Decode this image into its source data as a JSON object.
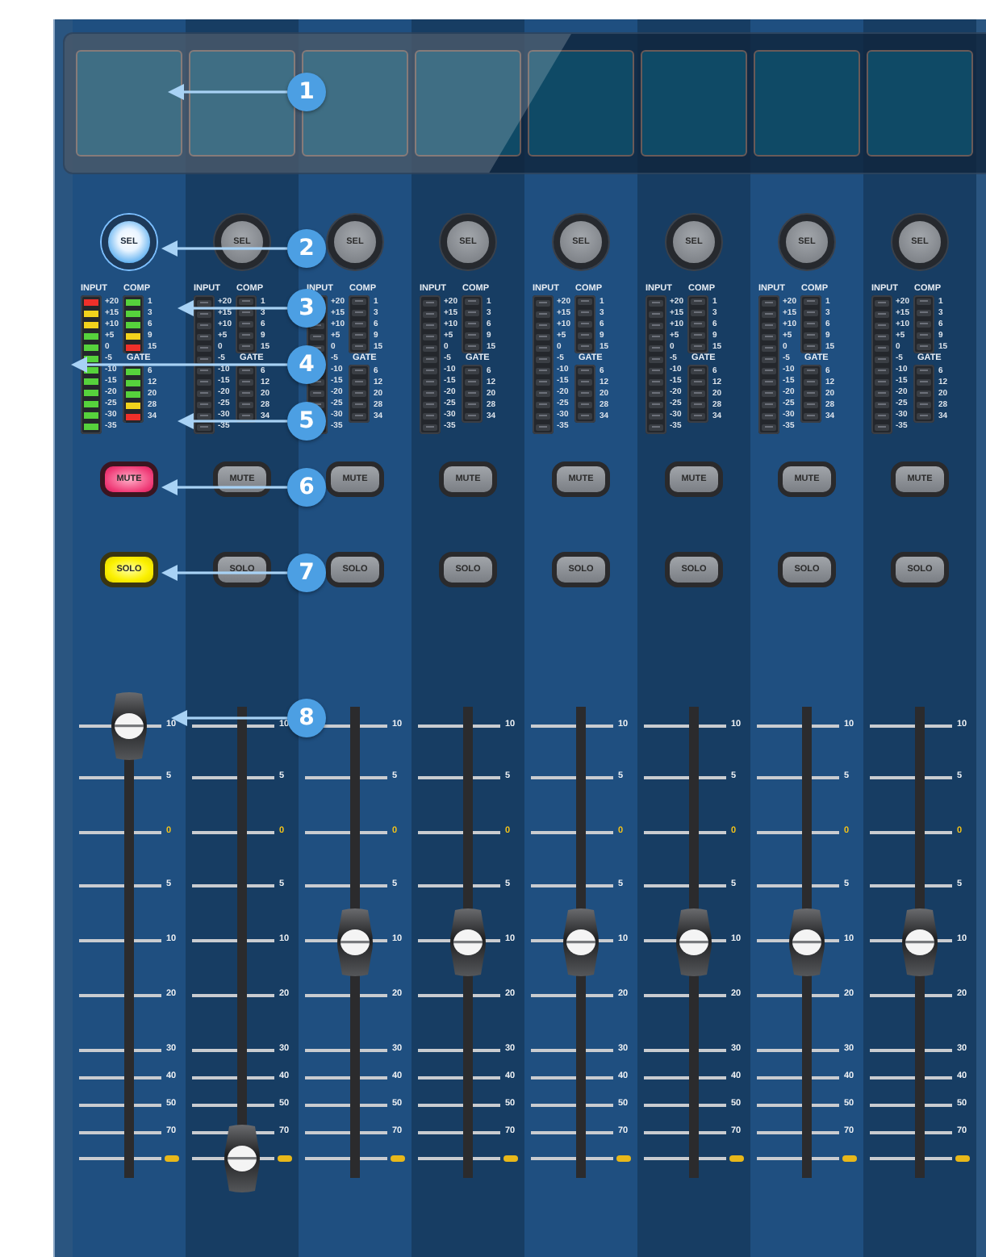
{
  "scribble_strips": [
    {
      "kind": "screen"
    },
    {
      "kind": "screen"
    },
    {
      "kind": "screen"
    },
    {
      "kind": "screen"
    },
    {
      "kind": "screen"
    },
    {
      "kind": "screen"
    },
    {
      "kind": "screen"
    },
    {
      "kind": "screen"
    }
  ],
  "channels": [
    {
      "select": {
        "label": "SEL",
        "selected": true
      },
      "meters": [
        {
          "kind": "input",
          "title": "INPUT",
          "scale": [
            "+20",
            "+15",
            "+10",
            "+5",
            "0",
            "-5",
            "-10",
            "-15",
            "-20",
            "-25",
            "-30",
            "-35"
          ],
          "level": 1
        },
        {
          "kind": "comp",
          "title": "COMP",
          "scale": [
            "1",
            "3",
            "6",
            "9",
            "15"
          ],
          "level": 1
        },
        {
          "kind": "gate",
          "title": "GATE",
          "scale": [
            "6",
            "12",
            "20",
            "28",
            "34"
          ],
          "level": 1
        }
      ],
      "mute": {
        "label": "MUTE",
        "on": true
      },
      "solo": {
        "label": "SOLO",
        "on": true
      },
      "fader": {
        "scale": [
          "10",
          "5",
          "0",
          "5",
          "10",
          "20",
          "30",
          "40",
          "50",
          "70"
        ],
        "level": 1
      }
    },
    {
      "select": {
        "label": "SEL",
        "selected": false
      },
      "meters": [
        {
          "kind": "input",
          "title": "INPUT",
          "scale": [
            "+20",
            "+15",
            "+10",
            "+5",
            "0",
            "-5",
            "-10",
            "-15",
            "-20",
            "-25",
            "-30",
            "-35"
          ],
          "level": 0
        },
        {
          "kind": "comp",
          "title": "COMP",
          "scale": [
            "1",
            "3",
            "6",
            "9",
            "15"
          ],
          "level": 0
        },
        {
          "kind": "gate",
          "title": "GATE",
          "scale": [
            "6",
            "12",
            "20",
            "28",
            "34"
          ],
          "level": 0
        }
      ],
      "mute": {
        "label": "MUTE",
        "on": false
      },
      "solo": {
        "label": "SOLO",
        "on": false
      },
      "fader": {
        "scale": [
          "10",
          "5",
          "0",
          "5",
          "10",
          "20",
          "30",
          "40",
          "50",
          "70"
        ],
        "level": 0
      }
    },
    {
      "select": {
        "label": "SEL",
        "selected": false
      },
      "meters": [
        {
          "kind": "input",
          "title": "INPUT",
          "scale": [
            "+20",
            "+15",
            "+10",
            "+5",
            "0",
            "-5",
            "-10",
            "-15",
            "-20",
            "-25",
            "-30",
            "-35"
          ],
          "level": 0
        },
        {
          "kind": "comp",
          "title": "COMP",
          "scale": [
            "1",
            "3",
            "6",
            "9",
            "15"
          ],
          "level": 0
        },
        {
          "kind": "gate",
          "title": "GATE",
          "scale": [
            "6",
            "12",
            "20",
            "28",
            "34"
          ],
          "level": 0
        }
      ],
      "mute": {
        "label": "MUTE",
        "on": false
      },
      "solo": {
        "label": "SOLO",
        "on": false
      },
      "fader": {
        "scale": [
          "10",
          "5",
          "0",
          "5",
          "10",
          "20",
          "30",
          "40",
          "50",
          "70"
        ],
        "level": 0.5
      }
    },
    {
      "select": {
        "label": "SEL",
        "selected": false
      },
      "meters": [
        {
          "kind": "input",
          "title": "INPUT",
          "scale": [
            "+20",
            "+15",
            "+10",
            "+5",
            "0",
            "-5",
            "-10",
            "-15",
            "-20",
            "-25",
            "-30",
            "-35"
          ],
          "level": 0
        },
        {
          "kind": "comp",
          "title": "COMP",
          "scale": [
            "1",
            "3",
            "6",
            "9",
            "15"
          ],
          "level": 0
        },
        {
          "kind": "gate",
          "title": "GATE",
          "scale": [
            "6",
            "12",
            "20",
            "28",
            "34"
          ],
          "level": 0
        }
      ],
      "mute": {
        "label": "MUTE",
        "on": false
      },
      "solo": {
        "label": "SOLO",
        "on": false
      },
      "fader": {
        "scale": [
          "10",
          "5",
          "0",
          "5",
          "10",
          "20",
          "30",
          "40",
          "50",
          "70"
        ],
        "level": 0.5
      }
    },
    {
      "select": {
        "label": "SEL",
        "selected": false
      },
      "meters": [
        {
          "kind": "input",
          "title": "INPUT",
          "scale": [
            "+20",
            "+15",
            "+10",
            "+5",
            "0",
            "-5",
            "-10",
            "-15",
            "-20",
            "-25",
            "-30",
            "-35"
          ],
          "level": 0
        },
        {
          "kind": "comp",
          "title": "COMP",
          "scale": [
            "1",
            "3",
            "6",
            "9",
            "15"
          ],
          "level": 0
        },
        {
          "kind": "gate",
          "title": "GATE",
          "scale": [
            "6",
            "12",
            "20",
            "28",
            "34"
          ],
          "level": 0
        }
      ],
      "mute": {
        "label": "MUTE",
        "on": false
      },
      "solo": {
        "label": "SOLO",
        "on": false
      },
      "fader": {
        "scale": [
          "10",
          "5",
          "0",
          "5",
          "10",
          "20",
          "30",
          "40",
          "50",
          "70"
        ],
        "level": 0.5
      }
    },
    {
      "select": {
        "label": "SEL",
        "selected": false
      },
      "meters": [
        {
          "kind": "input",
          "title": "INPUT",
          "scale": [
            "+20",
            "+15",
            "+10",
            "+5",
            "0",
            "-5",
            "-10",
            "-15",
            "-20",
            "-25",
            "-30",
            "-35"
          ],
          "level": 0
        },
        {
          "kind": "comp",
          "title": "COMP",
          "scale": [
            "1",
            "3",
            "6",
            "9",
            "15"
          ],
          "level": 0
        },
        {
          "kind": "gate",
          "title": "GATE",
          "scale": [
            "6",
            "12",
            "20",
            "28",
            "34"
          ],
          "level": 0
        }
      ],
      "mute": {
        "label": "MUTE",
        "on": false
      },
      "solo": {
        "label": "SOLO",
        "on": false
      },
      "fader": {
        "scale": [
          "10",
          "5",
          "0",
          "5",
          "10",
          "20",
          "30",
          "40",
          "50",
          "70"
        ],
        "level": 0.5
      }
    },
    {
      "select": {
        "label": "SEL",
        "selected": false
      },
      "meters": [
        {
          "kind": "input",
          "title": "INPUT",
          "scale": [
            "+20",
            "+15",
            "+10",
            "+5",
            "0",
            "-5",
            "-10",
            "-15",
            "-20",
            "-25",
            "-30",
            "-35"
          ],
          "level": 0
        },
        {
          "kind": "comp",
          "title": "COMP",
          "scale": [
            "1",
            "3",
            "6",
            "9",
            "15"
          ],
          "level": 0
        },
        {
          "kind": "gate",
          "title": "GATE",
          "scale": [
            "6",
            "12",
            "20",
            "28",
            "34"
          ],
          "level": 0
        }
      ],
      "mute": {
        "label": "MUTE",
        "on": false
      },
      "solo": {
        "label": "SOLO",
        "on": false
      },
      "fader": {
        "scale": [
          "10",
          "5",
          "0",
          "5",
          "10",
          "20",
          "30",
          "40",
          "50",
          "70"
        ],
        "level": 0.5
      }
    },
    {
      "select": {
        "label": "SEL",
        "selected": false
      },
      "meters": [
        {
          "kind": "input",
          "title": "INPUT",
          "scale": [
            "+20",
            "+15",
            "+10",
            "+5",
            "0",
            "-5",
            "-10",
            "-15",
            "-20",
            "-25",
            "-30",
            "-35"
          ],
          "level": 0
        },
        {
          "kind": "comp",
          "title": "COMP",
          "scale": [
            "1",
            "3",
            "6",
            "9",
            "15"
          ],
          "level": 0
        },
        {
          "kind": "gate",
          "title": "GATE",
          "scale": [
            "6",
            "12",
            "20",
            "28",
            "34"
          ],
          "level": 0
        }
      ],
      "mute": {
        "label": "MUTE",
        "on": false
      },
      "solo": {
        "label": "SOLO",
        "on": false
      },
      "fader": {
        "scale": [
          "10",
          "5",
          "0",
          "5",
          "10",
          "20",
          "30",
          "40",
          "50",
          "70"
        ],
        "level": 0.5
      }
    }
  ],
  "callouts": [
    {
      "number": "1"
    },
    {
      "number": "2"
    },
    {
      "number": "3"
    },
    {
      "number": "4"
    },
    {
      "number": "5"
    },
    {
      "number": "6"
    },
    {
      "number": "7"
    },
    {
      "number": "8"
    }
  ]
}
